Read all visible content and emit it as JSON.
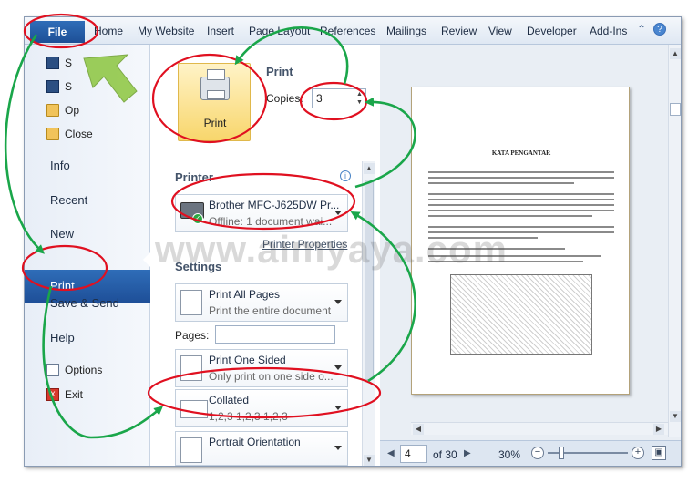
{
  "ribbon": {
    "file": "File",
    "tabs": [
      "Home",
      "My Website",
      "Insert",
      "Page Layout",
      "References",
      "Mailings",
      "Review",
      "View",
      "Developer",
      "Add-Ins"
    ],
    "help_icon": "help-icon",
    "minimize_icon": "chevron-up-icon"
  },
  "nav": {
    "save": "S",
    "save_as": "S",
    "open": "Op",
    "close": "Close",
    "info": "Info",
    "recent": "Recent",
    "new": "New",
    "print": "Print",
    "save_send": "Save & Send",
    "help": "Help",
    "options": "Options",
    "exit": "Exit"
  },
  "print_panel": {
    "heading": "Print",
    "button_label": "Print",
    "copies_label": "Copies:",
    "copies_value": "3",
    "printer_heading": "Printer",
    "printer_name": "Brother MFC-J625DW Pr...",
    "printer_status": "Offline: 1 document wai...",
    "printer_properties": "Printer Properties",
    "settings_heading": "Settings",
    "pages_label": "Pages:",
    "pages_value": "",
    "settings": [
      {
        "main": "Print All Pages",
        "sub": "Print the entire document"
      },
      {
        "main": "Print One Sided",
        "sub": "Only print on one side o..."
      },
      {
        "main": "Collated",
        "sub": "1,2,3    1,2,3    1,2,3"
      },
      {
        "main": "Portrait Orientation",
        "sub": ""
      }
    ]
  },
  "preview": {
    "page_title": "KATA PENGANTAR",
    "current_page": "4",
    "of_pages": "of 30",
    "zoom": "30%"
  },
  "watermark": "www.aimyaya.com",
  "colors": {
    "annotation_red": "#e01020",
    "annotation_green": "#1aa64a",
    "accent_blue": "#2a62ad"
  }
}
